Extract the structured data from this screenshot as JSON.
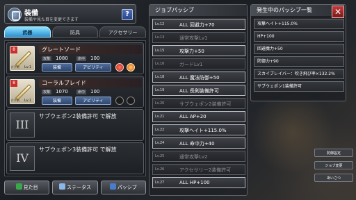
{
  "window": {
    "title": "装備",
    "subtitle": "装備や見た目を変更できます",
    "help_label": "?"
  },
  "tabs": [
    {
      "label": "武器",
      "active": true
    },
    {
      "label": "防具",
      "active": false
    },
    {
      "label": "アクセサリー",
      "active": false
    }
  ],
  "weapons": [
    {
      "name": "グレートソード",
      "attack_label": "攻撃",
      "attack": "1080",
      "hit_label": "命中",
      "hit": "100",
      "equip_label": "装備",
      "ability_label": "アビリティ",
      "level": "Lv.1",
      "badge": "8",
      "tag": "片手剣"
    },
    {
      "name": "コーラルブレイド",
      "attack_label": "攻撃",
      "attack": "1070",
      "hit_label": "命中",
      "hit": "100",
      "equip_label": "装備",
      "ability_label": "アビリティ",
      "level": "Lv.1",
      "badge": "8",
      "tag": "片手剣"
    }
  ],
  "sub_slots": [
    {
      "numeral": "III",
      "text": "サブウェポン2装備許可 で解放"
    },
    {
      "numeral": "IV",
      "text": "サブウェポン3装備許可 で解放"
    }
  ],
  "bottom_buttons": [
    {
      "label": "見た目"
    },
    {
      "label": "ステータス"
    },
    {
      "label": "パッシブ"
    }
  ],
  "job_passive": {
    "header": "ジョブパッシブ",
    "items": [
      {
        "lv": "Lv.12",
        "name": "ALL 回避力+70",
        "active": true
      },
      {
        "lv": "Lv.13",
        "name": "通常攻撃Lv1",
        "active": false
      },
      {
        "lv": "Lv.15",
        "name": "攻撃力+50",
        "active": true
      },
      {
        "lv": "Lv.16",
        "name": "ガードLv1",
        "active": false
      },
      {
        "lv": "Lv.18",
        "name": "ALL 魔法防御+50",
        "active": true
      },
      {
        "lv": "Lv.19",
        "name": "ALL 長剣装備許可",
        "active": true
      },
      {
        "lv": "Lv.20",
        "name": "サブウェポン2装備許可",
        "active": false
      },
      {
        "lv": "Lv.21",
        "name": "ALL AP+20",
        "active": true
      },
      {
        "lv": "Lv.22",
        "name": "攻撃ヘイト+115.0%",
        "active": true
      },
      {
        "lv": "Lv.24",
        "name": "ALL 命中力+40",
        "active": true
      },
      {
        "lv": "Lv.25",
        "name": "通常攻撃Lv2",
        "active": false
      },
      {
        "lv": "Lv.26",
        "name": "アクセサリー2装備許可",
        "active": false
      },
      {
        "lv": "Lv.27",
        "name": "ALL HP+100",
        "active": true
      }
    ]
  },
  "active_passive": {
    "header": "発生中のパッシブ一覧",
    "close_label": "✕",
    "items": [
      "攻撃ヘイト+115.0%",
      "HP+100",
      "回避魔力+50",
      "防御力+90",
      "スカイブレイバー：吹き飛び率×132.2%",
      "サブウェポン1装備許可"
    ]
  },
  "side_buttons": [
    {
      "label": "防御設定"
    },
    {
      "label": "ジョブ変更"
    },
    {
      "label": "あいさつ"
    }
  ]
}
